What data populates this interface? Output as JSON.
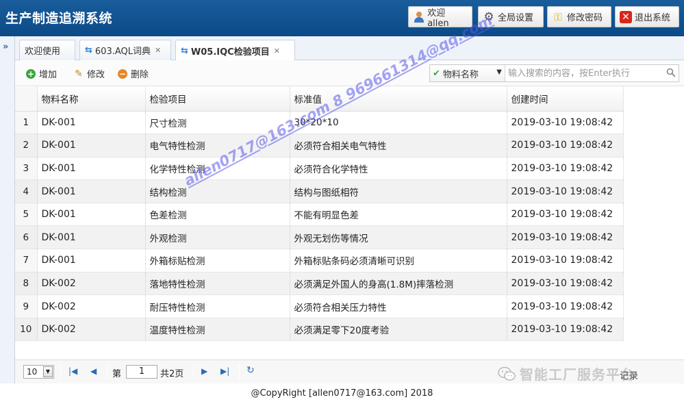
{
  "header": {
    "title": "生产制造追溯系统",
    "welcome_label": "欢迎 allen",
    "settings_label": "全局设置",
    "password_label": "修改密码",
    "logout_label": "退出系统"
  },
  "tabs": [
    {
      "label": "欢迎使用",
      "closable": false
    },
    {
      "label": "603.AQL词典",
      "closable": true
    },
    {
      "label": "W05.IQC检验项目",
      "closable": true,
      "active": true
    }
  ],
  "toolbar": {
    "add_label": "增加",
    "edit_label": "修改",
    "delete_label": "删除",
    "search_field": "物料名称",
    "search_placeholder": "输入搜索的内容，按Enter执行"
  },
  "grid": {
    "columns": [
      "物料名称",
      "检验项目",
      "标准值",
      "创建时间"
    ],
    "rows": [
      {
        "n": "1",
        "material": "DK-001",
        "item": "尺寸检测",
        "standard": "30*20*10",
        "created": "2019-03-10 19:08:42"
      },
      {
        "n": "2",
        "material": "DK-001",
        "item": "电气特性检测",
        "standard": "必须符合相关电气特性",
        "created": "2019-03-10 19:08:42"
      },
      {
        "n": "3",
        "material": "DK-001",
        "item": "化学特性检测",
        "standard": "必须符合化学特性",
        "created": "2019-03-10 19:08:42"
      },
      {
        "n": "4",
        "material": "DK-001",
        "item": "结构检测",
        "standard": "结构与图纸相符",
        "created": "2019-03-10 19:08:42"
      },
      {
        "n": "5",
        "material": "DK-001",
        "item": "色差检测",
        "standard": "不能有明显色差",
        "created": "2019-03-10 19:08:42"
      },
      {
        "n": "6",
        "material": "DK-001",
        "item": "外观检测",
        "standard": "外观无划伤等情况",
        "created": "2019-03-10 19:08:42"
      },
      {
        "n": "7",
        "material": "DK-001",
        "item": "外箱标贴检测",
        "standard": "外箱标贴条码必须清晰可识别",
        "created": "2019-03-10 19:08:42"
      },
      {
        "n": "8",
        "material": "DK-002",
        "item": "落地特性检测",
        "standard": "必须满足外国人的身高(1.8M)摔落检测",
        "created": "2019-03-10 19:08:42"
      },
      {
        "n": "9",
        "material": "DK-002",
        "item": "耐压特性检测",
        "standard": "必须符合相关压力特性",
        "created": "2019-03-10 19:08:42"
      },
      {
        "n": "10",
        "material": "DK-002",
        "item": "温度特性检测",
        "standard": "必须满足零下20度考验",
        "created": "2019-03-10 19:08:42"
      }
    ]
  },
  "pager": {
    "page_size": "10",
    "page_prefix": "第",
    "current_page": "1",
    "total_pages": "共2页",
    "overlay_text": "智能工厂服务平台",
    "records_fragment": "记录"
  },
  "watermark": "allen0717@163.com 8 969661314@qq.com",
  "footer": "@CopyRight [allen0717@163.com] 2018",
  "colors": {
    "header_bg": "#0b4a86",
    "accent": "#2a6bb6"
  }
}
